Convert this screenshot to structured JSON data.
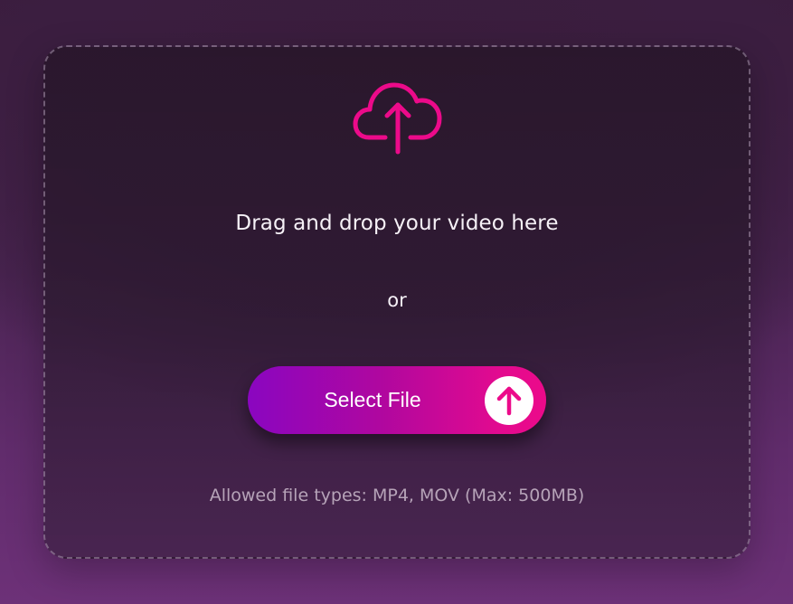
{
  "upload": {
    "cloud_icon": "cloud-upload-icon",
    "headline": "Drag and drop your video here",
    "or_text": "or",
    "button_label": "Select File",
    "button_icon": "arrow-up-icon",
    "allowed_types": "Allowed file types: MP4, MOV (Max: 500MB)"
  },
  "colors": {
    "accent": "#ec0a8a",
    "button_gradient_start": "#8a06c0",
    "button_gradient_end": "#ec0a8a",
    "text": "#f6f1f7",
    "muted_text": "#b6a3b8"
  }
}
